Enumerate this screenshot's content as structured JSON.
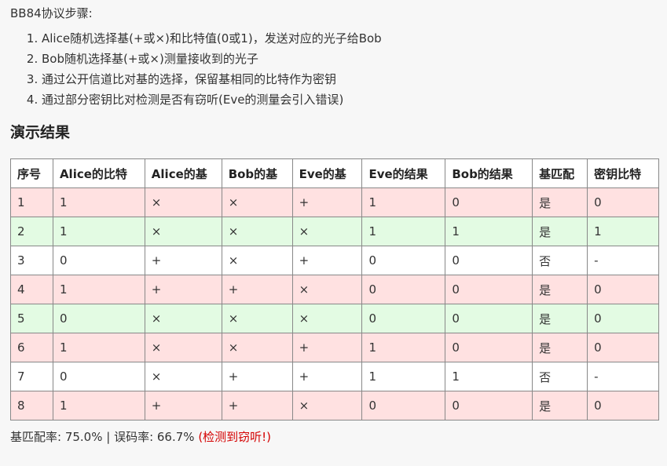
{
  "intro": "BB84协议步骤:",
  "steps": [
    "Alice随机选择基(+或×)和比特值(0或1)，发送对应的光子给Bob",
    "Bob随机选择基(+或×)测量接收到的光子",
    "通过公开信道比对基的选择，保留基相同的比特作为密钥",
    "通过部分密钥比对检测是否有窃听(Eve的测量会引入错误)"
  ],
  "section_title": "演示结果",
  "table": {
    "headers": [
      "序号",
      "Alice的比特",
      "Alice的基",
      "Bob的基",
      "Eve的基",
      "Eve的结果",
      "Bob的结果",
      "基匹配",
      "密钥比特"
    ],
    "rows": [
      {
        "cells": [
          "1",
          "1",
          "×",
          "×",
          "+",
          "1",
          "0",
          "是",
          "0"
        ],
        "tone": "red"
      },
      {
        "cells": [
          "2",
          "1",
          "×",
          "×",
          "×",
          "1",
          "1",
          "是",
          "1"
        ],
        "tone": "green"
      },
      {
        "cells": [
          "3",
          "0",
          "+",
          "×",
          "+",
          "0",
          "0",
          "否",
          "-"
        ],
        "tone": "white"
      },
      {
        "cells": [
          "4",
          "1",
          "+",
          "+",
          "×",
          "0",
          "0",
          "是",
          "0"
        ],
        "tone": "red"
      },
      {
        "cells": [
          "5",
          "0",
          "×",
          "×",
          "×",
          "0",
          "0",
          "是",
          "0"
        ],
        "tone": "green"
      },
      {
        "cells": [
          "6",
          "1",
          "×",
          "×",
          "+",
          "1",
          "0",
          "是",
          "0"
        ],
        "tone": "red"
      },
      {
        "cells": [
          "7",
          "0",
          "×",
          "+",
          "+",
          "1",
          "1",
          "否",
          "-"
        ],
        "tone": "white"
      },
      {
        "cells": [
          "8",
          "1",
          "+",
          "+",
          "×",
          "0",
          "0",
          "是",
          "0"
        ],
        "tone": "red"
      }
    ]
  },
  "summary": {
    "text": "基匹配率: 75.0% | 误码率: 66.7% ",
    "alert": "(检测到窃听!)",
    "alert_color": "#d40000"
  }
}
